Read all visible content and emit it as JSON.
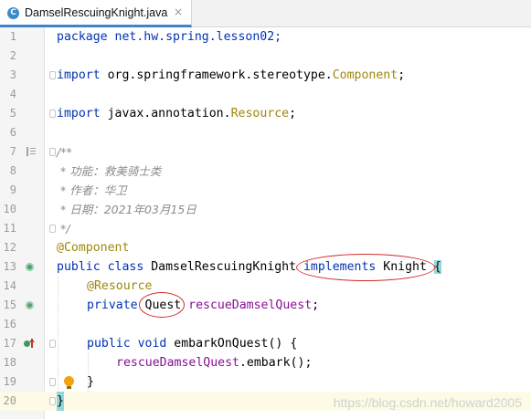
{
  "tab": {
    "title": "DamselRescuingKnight.java",
    "close": "×",
    "file_icon_letter": "C"
  },
  "lines": [
    {
      "n": "1"
    },
    {
      "n": "2"
    },
    {
      "n": "3"
    },
    {
      "n": "4"
    },
    {
      "n": "5"
    },
    {
      "n": "6"
    },
    {
      "n": "7"
    },
    {
      "n": "8"
    },
    {
      "n": "9"
    },
    {
      "n": "10"
    },
    {
      "n": "11"
    },
    {
      "n": "12"
    },
    {
      "n": "13"
    },
    {
      "n": "14"
    },
    {
      "n": "15"
    },
    {
      "n": "16"
    },
    {
      "n": "17"
    },
    {
      "n": "18"
    },
    {
      "n": "19"
    },
    {
      "n": "20"
    }
  ],
  "code": {
    "l1": "package net.hw.spring.lesson02;",
    "l3_kw": "import",
    "l3_pkg": " org.springframework.stereotype.",
    "l3_cls": "Component",
    "l3_end": ";",
    "l5_kw": "import",
    "l5_pkg": " javax.annotation.",
    "l5_cls": "Resource",
    "l5_end": ";",
    "l7": "/**",
    "l8": " * 功能：救美骑士类",
    "l9": " * 作者：华卫",
    "l10_a": " * 日期：",
    "l10_b": "2021",
    "l10_c": "年",
    "l10_d": "03",
    "l10_e": "月",
    "l10_f": "15",
    "l10_g": "日",
    "l11": " */",
    "l12": "@Component",
    "l13_a": "public class",
    "l13_b": " DamselRescuingKnight ",
    "l13_c": "implements",
    "l13_d": " Knight ",
    "l13_e": "{",
    "l14": "@Resource",
    "l15_a": "private",
    "l15_b": " Quest ",
    "l15_c": "rescueDamselQuest",
    "l15_d": ";",
    "l17_a": "public void",
    "l17_b": " embarkOnQuest() {",
    "l18_a": "rescueDamselQuest",
    "l18_b": ".embark();",
    "l19": "}",
    "l20": "}"
  },
  "watermark": "https://blog.csdn.net/howard2005",
  "colors": {
    "keyword": "#0033b3",
    "annotation": "#9e880d",
    "class_ref": "#b200b2",
    "field": "#871094",
    "comment": "#8c8c8c",
    "accent": "#4083c9",
    "highlight_oval": "#d42a2a"
  }
}
